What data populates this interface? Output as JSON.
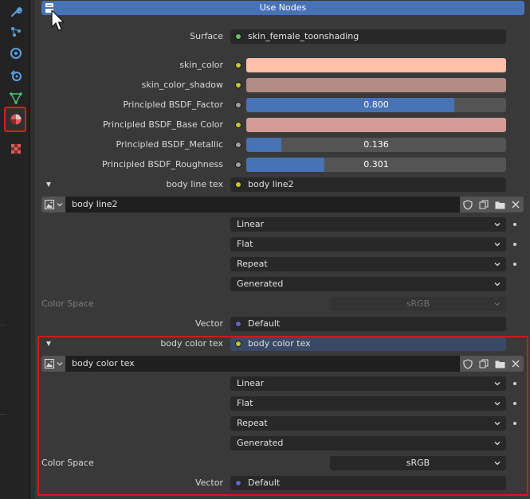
{
  "sidebar": {
    "tabs": [
      {
        "icon": "wrench-icon",
        "color": "#5ea0e0"
      },
      {
        "icon": "particles-icon",
        "color": "#5ea0e0"
      },
      {
        "icon": "physics-icon",
        "color": "#5ea0e0"
      },
      {
        "icon": "constraints-icon",
        "color": "#5ea0e0"
      },
      {
        "icon": "mesh-data-icon",
        "color": "#4ec07a"
      },
      {
        "icon": "material-icon",
        "color": "#e05858"
      },
      {
        "icon": "texture-icon",
        "color": "#e05858"
      }
    ],
    "active_tab": "material-icon"
  },
  "use_nodes_label": "Use Nodes",
  "surface": {
    "label": "Surface",
    "value": "skin_female_toonshading"
  },
  "props": {
    "skin_color": {
      "label": "skin_color",
      "color": "#ffbfa8"
    },
    "skin_color_shadow": {
      "label": "skin_color_shadow",
      "color": "#b48c86"
    },
    "bsdf_factor": {
      "label": "Principled BSDF_Factor",
      "value": "0.800",
      "fraction": 0.8
    },
    "bsdf_base_color": {
      "label": "Principled BSDF_Base Color",
      "color": "#d49a96"
    },
    "bsdf_metallic": {
      "label": "Principled BSDF_Metallic",
      "value": "0.136",
      "fraction": 0.136
    },
    "bsdf_roughness": {
      "label": "Principled BSDF_Roughness",
      "value": "0.301",
      "fraction": 0.301
    }
  },
  "line_tex": {
    "label": "body line tex",
    "value": "body line2",
    "image_name": "body line2",
    "interpolation": "Linear",
    "projection": "Flat",
    "extension": "Repeat",
    "source": "Generated",
    "color_space_label": "Color Space",
    "color_space": "sRGB",
    "vector_label": "Vector",
    "vector": "Default"
  },
  "color_tex": {
    "label": "body color tex",
    "value": "body color tex",
    "image_name": "body color tex",
    "interpolation": "Linear",
    "projection": "Flat",
    "extension": "Repeat",
    "source": "Generated",
    "color_space_label": "Color Space",
    "color_space": "sRGB",
    "vector_label": "Vector",
    "vector": "Default"
  },
  "colors": {
    "accent": "#4772b3",
    "highlight_box": "#d01a1a"
  }
}
